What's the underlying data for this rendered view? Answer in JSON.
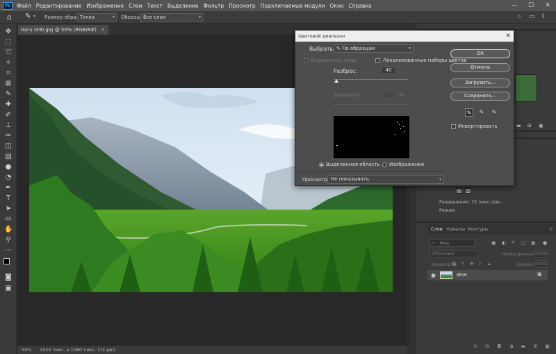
{
  "app": {
    "logo": "Ps"
  },
  "menu": [
    "Файл",
    "Редактирование",
    "Изображение",
    "Слои",
    "Текст",
    "Выделение",
    "Фильтр",
    "Просмотр",
    "Подключаемые модули",
    "Окно",
    "Справка"
  ],
  "window_controls": {
    "minimize": "—",
    "maximize": "☐",
    "close": "✕"
  },
  "options_bar": {
    "sample_size_label": "Размер образца:",
    "sample_size_value": "Точка",
    "sample_label": "Образцы:",
    "sample_value": "Все слои"
  },
  "document": {
    "tab_title": "Gory (49).jpg @ 50% (RGB/8#)",
    "zoom": "50%",
    "status": "1920 пикс. x 1080 пикс. (72 ppi)"
  },
  "dialog": {
    "title": "Цветовой диапазон",
    "select_label": "Выбрать:",
    "select_value": "По образцам",
    "detect_faces_label": "Определить лица",
    "localized_label": "Локализованные наборы цветов",
    "fuzziness_label": "Разброс:",
    "fuzziness_value": "40",
    "fuzziness_fraction": 0.04,
    "range_label": "Диапазон:",
    "range_unit": "%",
    "radio_selection": "Выделенная область",
    "radio_image": "Изображение",
    "preview_label": "Просмотр:",
    "preview_value": "Не показывать",
    "ok": "ОК",
    "cancel": "Отмена",
    "load": "Загрузить...",
    "save": "Сохранить...",
    "invert_label": "Инвертировать"
  },
  "right_panel": {
    "resolution": "Разрешение: 72 пикс./дю...",
    "mode": "Режим"
  },
  "layers": {
    "tabs": [
      "Слои",
      "Каналы",
      "Контуры"
    ],
    "search_placeholder": "Вид",
    "blend_mode": "Обычные",
    "opacity_label": "Непрозрачность:",
    "opacity_value": "100%",
    "lock_label": "Закрепить:",
    "fill_label": "Заливка:",
    "fill_value": "100%",
    "layer_name": "Фон"
  },
  "colors": {
    "accent": "#31a8ff",
    "dialog_bg": "#4d4d4d",
    "app_bg": "#323232"
  }
}
